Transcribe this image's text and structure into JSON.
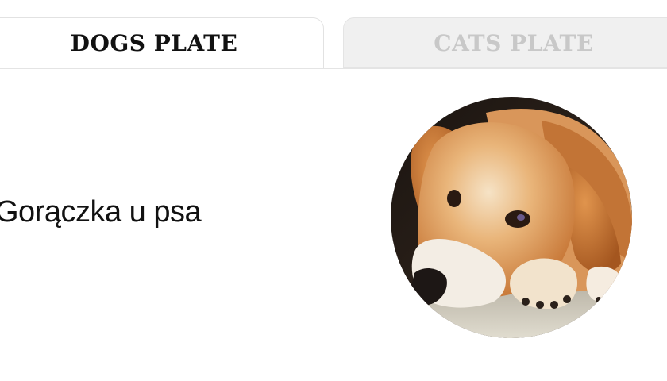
{
  "tabs": {
    "dogs_label": "DOGS PLATE",
    "cats_label": "CATS PLATE",
    "active": "dogs"
  },
  "card": {
    "title": "Gorączka u psa",
    "image_subject": "dog-lying-down"
  },
  "colors": {
    "active_tab_text": "#111111",
    "inactive_tab_text": "#c8c8c8",
    "inactive_tab_bg": "#f0f0f0",
    "divider": "#e4e4e4"
  }
}
